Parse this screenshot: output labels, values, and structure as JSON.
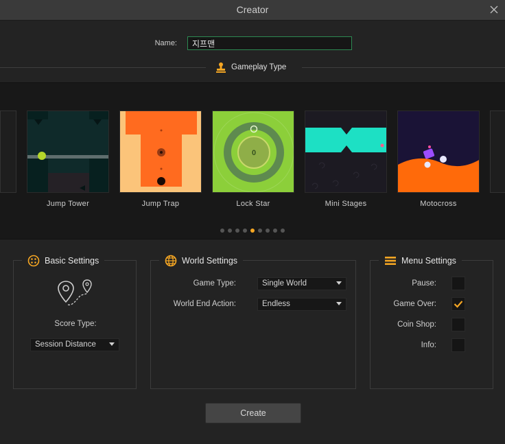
{
  "window": {
    "title": "Creator"
  },
  "name_field": {
    "label": "Name:",
    "value": "지프맨"
  },
  "gameplay": {
    "header": "Gameplay Type",
    "cards": [
      {
        "label": "Jump Tower"
      },
      {
        "label": "Jump Trap"
      },
      {
        "label": "Lock Star",
        "counter": "0"
      },
      {
        "label": "Mini Stages"
      },
      {
        "label": "Motocross"
      }
    ],
    "pagination": {
      "total": 9,
      "active_index": 4
    },
    "colors": {
      "accent": "#f5a623"
    }
  },
  "basic_settings": {
    "title": "Basic Settings",
    "score_type_label": "Score Type:",
    "score_type_value": "Session Distance"
  },
  "world_settings": {
    "title": "World Settings",
    "game_type_label": "Game Type:",
    "game_type_value": "Single World",
    "world_end_label": "World End Action:",
    "world_end_value": "Endless"
  },
  "menu_settings": {
    "title": "Menu Settings",
    "items": [
      {
        "label": "Pause:",
        "checked": false
      },
      {
        "label": "Game Over:",
        "checked": true
      },
      {
        "label": "Coin Shop:",
        "checked": false
      },
      {
        "label": "Info:",
        "checked": false
      }
    ]
  },
  "actions": {
    "create_label": "Create"
  }
}
